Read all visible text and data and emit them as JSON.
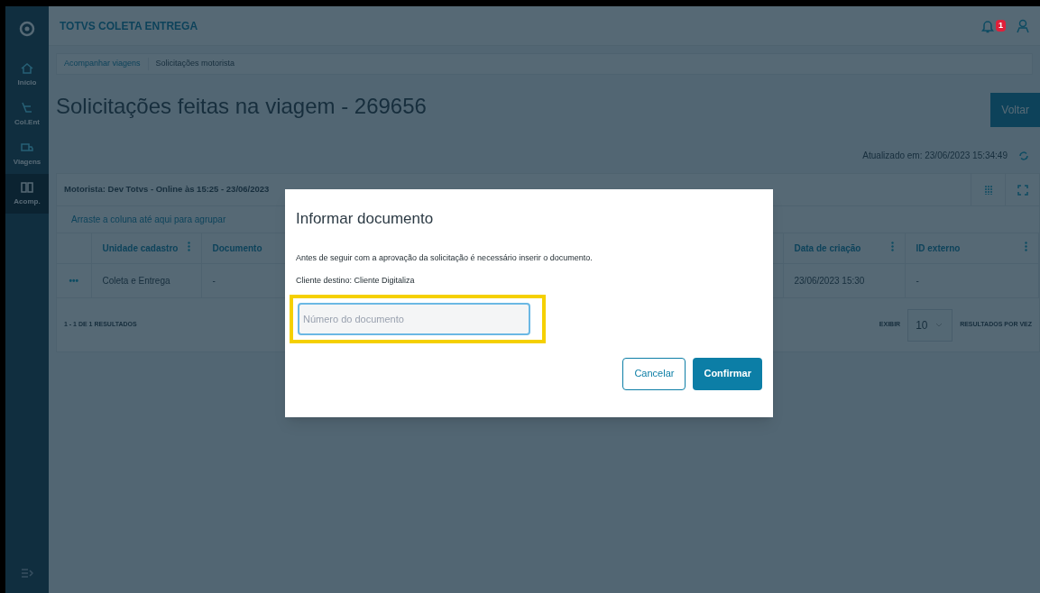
{
  "app": {
    "title": "TOTVS COLETA ENTREGA",
    "notification_count": "1"
  },
  "sidebar": {
    "items": [
      {
        "label": "Início",
        "selected": false
      },
      {
        "label": "Col.Ent",
        "selected": false
      },
      {
        "label": "Viagens",
        "selected": false
      },
      {
        "label": "Acomp.",
        "selected": true
      }
    ]
  },
  "breadcrumb": [
    "Acompanhar viagens",
    "Solicitações motorista"
  ],
  "page": {
    "title": "Solicitações feitas na viagem - 269656",
    "back_button": "Voltar",
    "updated": "Atualizado em: 23/06/2023 15:34:49"
  },
  "grid": {
    "driver": "Motorista: Dev Totvs - Online às 15:25 - 23/06/2023",
    "group_hint": "Arraste a coluna até aqui para agrupar",
    "columns": [
      "Unidade cadastro",
      "Documento",
      "Data de criação",
      "ID externo"
    ],
    "rows": [
      {
        "actions": "•••",
        "cells": [
          "Coleta e Entrega",
          "-",
          "23/06/2023 15:30",
          "-"
        ]
      }
    ],
    "results": "1 - 1 DE 1 RESULTADOS",
    "show_label": "EXIBIR",
    "page_size": "10",
    "per_page_label": "RESULTADOS POR VEZ"
  },
  "dialog": {
    "title": "Informar documento",
    "message": "Antes de seguir com a aprovação da solicitação é necessário inserir o documento.",
    "client": "Cliente destino: Cliente Digitaliza",
    "field": {
      "placeholder": "Número do documento",
      "highlighted": true
    },
    "buttons": [
      {
        "label": "Cancelar",
        "kind": "secondary"
      },
      {
        "label": "Confirmar",
        "kind": "primary"
      }
    ]
  }
}
